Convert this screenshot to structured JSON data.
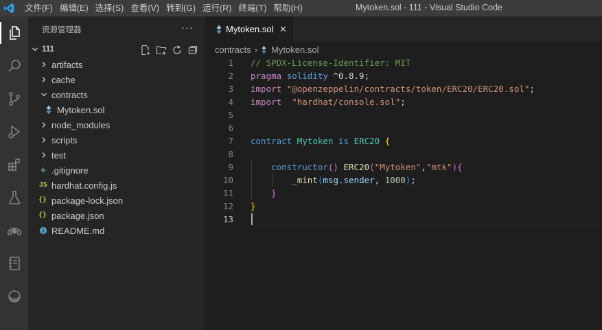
{
  "menu": [
    "文件(F)",
    "编辑(E)",
    "选择(S)",
    "查看(V)",
    "转到(G)",
    "运行(R)",
    "终端(T)",
    "帮助(H)"
  ],
  "window_title": "Mytoken.sol - 111 - Visual Studio Code",
  "sidebar": {
    "title": "资源管理器",
    "more": "···",
    "root": "111",
    "items": [
      {
        "label": "artifacts",
        "kind": "folder"
      },
      {
        "label": "cache",
        "kind": "folder"
      },
      {
        "label": "contracts",
        "kind": "folder-open"
      },
      {
        "label": "Mytoken.sol",
        "kind": "sol"
      },
      {
        "label": "node_modules",
        "kind": "folder"
      },
      {
        "label": "scripts",
        "kind": "folder"
      },
      {
        "label": "test",
        "kind": "folder"
      },
      {
        "label": ".gitignore",
        "kind": "git"
      },
      {
        "label": "hardhat.config.js",
        "kind": "js",
        "icon_text": "JS"
      },
      {
        "label": "package-lock.json",
        "kind": "json",
        "icon_text": "{}"
      },
      {
        "label": "package.json",
        "kind": "json",
        "icon_text": "{}"
      },
      {
        "label": "README.md",
        "kind": "info"
      }
    ]
  },
  "tab": {
    "label": "Mytoken.sol",
    "close": "✕"
  },
  "breadcrumb": {
    "folder": "contracts",
    "sep": "›",
    "file": "Mytoken.sol"
  },
  "editor": {
    "line_numbers": [
      "1",
      "2",
      "3",
      "4",
      "5",
      "6",
      "7",
      "8",
      "9",
      "10",
      "11",
      "12",
      "13"
    ],
    "current_line": 13,
    "lines": [
      [
        {
          "t": "// SPDX-License-Identifier: MIT",
          "c": "comment"
        }
      ],
      [
        {
          "t": "pragma",
          "c": "kw"
        },
        {
          "t": " ",
          "c": ""
        },
        {
          "t": "solidity",
          "c": "blue"
        },
        {
          "t": " ^0.8.9;",
          "c": ""
        }
      ],
      [
        {
          "t": "import",
          "c": "kw"
        },
        {
          "t": " ",
          "c": ""
        },
        {
          "t": "\"@openzeppelin/contracts/token/ERC20/ERC20.sol\"",
          "c": "str"
        },
        {
          "t": ";",
          "c": ""
        }
      ],
      [
        {
          "t": "import",
          "c": "kw"
        },
        {
          "t": "  ",
          "c": ""
        },
        {
          "t": "\"hardhat/console.sol\"",
          "c": "str"
        },
        {
          "t": ";",
          "c": ""
        }
      ],
      [],
      [],
      [
        {
          "t": "contract",
          "c": "blue"
        },
        {
          "t": " ",
          "c": ""
        },
        {
          "t": "Mytoken",
          "c": "type"
        },
        {
          "t": " ",
          "c": ""
        },
        {
          "t": "is",
          "c": "blue"
        },
        {
          "t": " ",
          "c": ""
        },
        {
          "t": "ERC20",
          "c": "type"
        },
        {
          "t": " ",
          "c": ""
        },
        {
          "t": "{",
          "c": "b1"
        }
      ],
      [],
      [
        {
          "t": "    ",
          "c": ""
        },
        {
          "t": "constructor",
          "c": "blue"
        },
        {
          "t": "()",
          "c": "b2"
        },
        {
          "t": " ",
          "c": ""
        },
        {
          "t": "ERC20",
          "c": "fn"
        },
        {
          "t": "(",
          "c": "b2"
        },
        {
          "t": "\"Mytoken\"",
          "c": "str"
        },
        {
          "t": ",",
          "c": ""
        },
        {
          "t": "\"mtk\"",
          "c": "str"
        },
        {
          "t": ")",
          "c": "b2"
        },
        {
          "t": "{",
          "c": "b2"
        }
      ],
      [
        {
          "t": "        ",
          "c": ""
        },
        {
          "t": "_mint",
          "c": "fn"
        },
        {
          "t": "(",
          "c": "b3"
        },
        {
          "t": "msg",
          "c": "var"
        },
        {
          "t": ".",
          "c": ""
        },
        {
          "t": "sender",
          "c": "var"
        },
        {
          "t": ", ",
          "c": ""
        },
        {
          "t": "1000",
          "c": "num"
        },
        {
          "t": ")",
          "c": "b3"
        },
        {
          "t": ";",
          "c": ""
        }
      ],
      [
        {
          "t": "    ",
          "c": ""
        },
        {
          "t": "}",
          "c": "b2"
        }
      ],
      [
        {
          "t": "}",
          "c": "b1"
        }
      ],
      []
    ]
  },
  "colors": {
    "titlebar": "#3c3c3c",
    "activitybar": "#333333",
    "sidebar": "#252526",
    "editor": "#1e1e1e",
    "accent": "#007acc"
  },
  "icons": {
    "activity": [
      "explorer-icon",
      "search-icon",
      "source-control-icon",
      "run-debug-icon",
      "extensions-icon",
      "testing-icon",
      "remote-icon",
      "notebook-icon",
      "solidity-icon"
    ]
  }
}
